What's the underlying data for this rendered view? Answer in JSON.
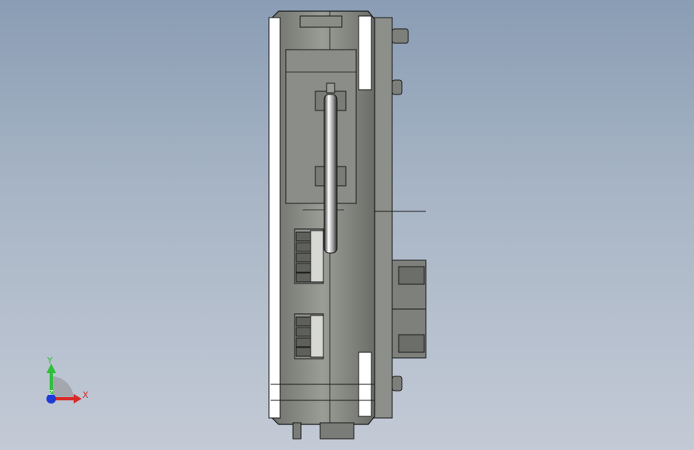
{
  "viewport": {
    "background_top": "#8a9db4",
    "background_bottom": "#c3cad6",
    "model_body_color": "#8a8c86",
    "model_edge_color": "#1b1b1b",
    "highlight_color": "#ffffff"
  },
  "triad": {
    "y_label": "Y",
    "x_label": "X",
    "z_label": "Z",
    "y_color": "#2fbf3a",
    "x_color": "#d92a2a",
    "z_color": "#1f3bd6"
  }
}
